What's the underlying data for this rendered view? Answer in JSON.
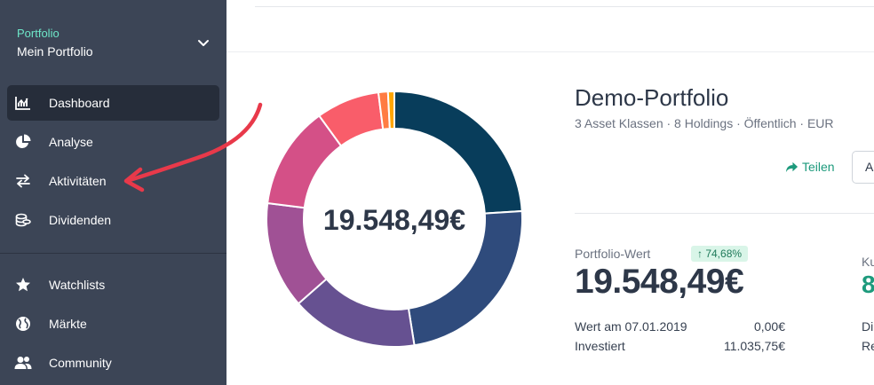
{
  "sidebar": {
    "portfolio_label": "Portfolio",
    "portfolio_name": "Mein Portfolio",
    "items": [
      {
        "label": "Dashboard",
        "icon": "chart-line-icon",
        "active": true
      },
      {
        "label": "Analyse",
        "icon": "pie-chart-icon",
        "active": false
      },
      {
        "label": "Aktivitäten",
        "icon": "swap-arrows-icon",
        "active": false
      },
      {
        "label": "Dividenden",
        "icon": "coins-icon",
        "active": false
      }
    ],
    "secondary_items": [
      {
        "label": "Watchlists",
        "icon": "star-icon"
      },
      {
        "label": "Märkte",
        "icon": "globe-icon"
      },
      {
        "label": "Community",
        "icon": "users-icon"
      }
    ]
  },
  "portfolio": {
    "title": "Demo-Portfolio",
    "meta": "3 Asset Klassen · 8 Holdings · Öffentlich · EUR",
    "share_label": "Teilen",
    "action_label": "A",
    "value_label": "Portfolio-Wert",
    "change_badge": "↑ 74,68%",
    "value": "19.548,49€",
    "rows": [
      {
        "label": "Wert am 07.01.2019",
        "value": "0,00€"
      },
      {
        "label": "Investiert",
        "value": "11.035,75€"
      }
    ],
    "cut_label": "Ku",
    "cut_value": "8",
    "cut_rows": [
      "Di",
      "Re"
    ]
  },
  "chart_data": {
    "type": "pie",
    "center_label": "19.548,49€",
    "slices": [
      {
        "value": 24.0,
        "color": "#083d5b"
      },
      {
        "value": 23.5,
        "color": "#2f4b7c"
      },
      {
        "value": 16.0,
        "color": "#665191"
      },
      {
        "value": 13.5,
        "color": "#a05195"
      },
      {
        "value": 13.0,
        "color": "#d45087"
      },
      {
        "value": 8.0,
        "color": "#f95d6a"
      },
      {
        "value": 1.2,
        "color": "#ff7c43"
      },
      {
        "value": 0.8,
        "color": "#ffa600"
      }
    ]
  },
  "colors": {
    "sidebar_bg": "#3c4556",
    "accent": "#1d9a7c",
    "annotation_arrow": "#e8394a"
  }
}
